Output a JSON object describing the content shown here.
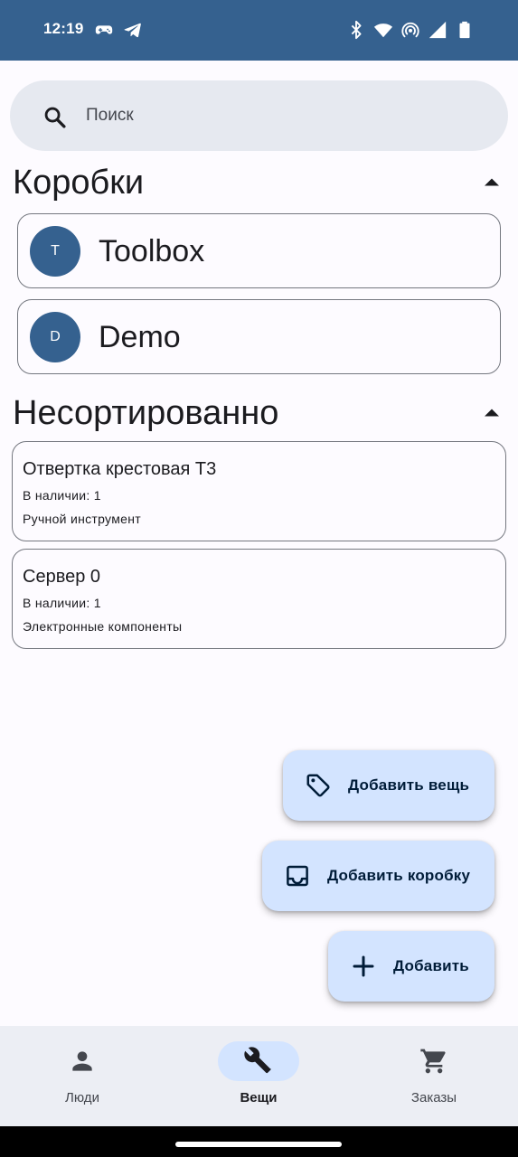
{
  "status_bar": {
    "time": "12:19",
    "icons_left": [
      "game-controller-icon",
      "telegram-icon"
    ],
    "icons_right": [
      "bluetooth-icon",
      "wifi-icon",
      "hotspot-icon",
      "cellular-signal-icon",
      "battery-icon"
    ],
    "background": "#35618f"
  },
  "search": {
    "placeholder": "Поиск",
    "value": "",
    "icon": "search-icon"
  },
  "boxes_section": {
    "title": "Коробки",
    "expanded": true,
    "items": [
      {
        "initial": "T",
        "name": "Toolbox"
      },
      {
        "initial": "D",
        "name": "Demo"
      }
    ]
  },
  "unsorted_section": {
    "title": "Несортированно",
    "expanded": true,
    "items": [
      {
        "name": "Отвертка крестовая T3",
        "stock": "В наличии: 1",
        "category": "Ручной инструмент"
      },
      {
        "name": "Сервер 0",
        "stock": "В наличии: 1",
        "category": "Электронные компоненты"
      }
    ]
  },
  "fabs": {
    "add_item": {
      "label": "Добавить вещь",
      "icon": "tag-icon"
    },
    "add_box": {
      "label": "Добавить коробку",
      "icon": "inbox-tray-icon"
    },
    "add": {
      "label": "Добавить",
      "icon": "plus-icon"
    }
  },
  "bottom_nav": {
    "items": [
      {
        "label": "Люди",
        "icon": "person-icon",
        "active": false
      },
      {
        "label": "Вещи",
        "icon": "wrench-icon",
        "active": true
      },
      {
        "label": "Заказы",
        "icon": "shopping-cart-icon",
        "active": false
      }
    ]
  },
  "colors": {
    "accent": "#35618f",
    "fab_container": "#d3e4ff",
    "surface": "#fdfbff"
  }
}
